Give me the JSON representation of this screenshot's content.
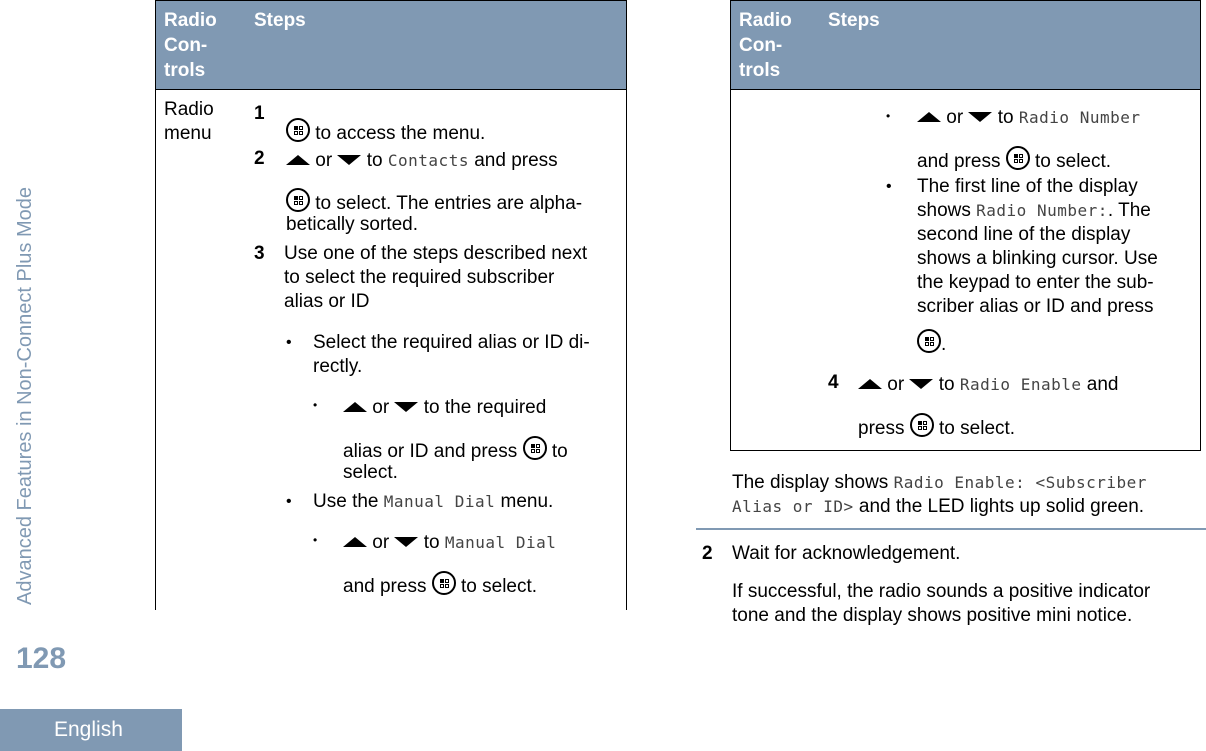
{
  "sidebar": {
    "section_title": "Advanced Features in Non-Connect Plus Mode",
    "page_number": "128",
    "language": "English"
  },
  "table_header": {
    "col1": [
      "Radio",
      "Con-",
      "trols"
    ],
    "col2": "Steps"
  },
  "left_table": {
    "row_label": [
      "Radio",
      "menu"
    ],
    "step1": {
      "num": "1",
      "text": "to access the menu."
    },
    "step2": {
      "num": "2",
      "or": "or",
      "to": "to",
      "target": "Contacts",
      "and_press": "and press",
      "line2": "to select. The entries are alpha-",
      "line3": "betically sorted."
    },
    "step3": {
      "num": "3",
      "lines": [
        "Use one of the steps described next",
        "to select the required subscriber",
        "alias or ID"
      ]
    },
    "bullet1": {
      "lines": [
        "Select the required alias or ID di-",
        "rectly."
      ]
    },
    "sub1": {
      "or": "or",
      "text": "to the required",
      "line2a": "alias or ID and press",
      "line2b": "to",
      "line3": "select."
    },
    "bullet2": {
      "pre": "Use the",
      "mono": "Manual Dial",
      "post": "menu."
    },
    "sub2": {
      "or": "or",
      "to": "to",
      "mono": "Manual Dial",
      "line2a": "and press",
      "line2b": "to select."
    }
  },
  "right_table": {
    "sub1": {
      "or": "or",
      "to": "to",
      "mono": "Radio Number",
      "line2a": "and press",
      "line2b": "to select."
    },
    "bullet2": {
      "line1": "The first line of the display",
      "pre": "shows",
      "mono": "Radio Number:",
      "post": ". The",
      "lines": [
        "second line of the display",
        "shows a blinking cursor. Use",
        "the keypad to enter the sub-",
        "scriber alias or ID and press"
      ],
      "end": "."
    },
    "step4": {
      "num": "4",
      "or": "or",
      "to": "to",
      "mono": "Radio Enable",
      "post": "and",
      "line2a": "press",
      "line2b": "to select."
    }
  },
  "after_table": {
    "pre": "The display shows",
    "mono1": "Radio Enable: <Subscriber",
    "mono2": "Alias or ID>",
    "post": "and the LED lights up solid green."
  },
  "step2": {
    "num": "2",
    "text": "Wait for acknowledgement.",
    "lines": [
      "If successful, the radio sounds a positive indicator",
      "tone and the display shows positive mini notice."
    ]
  }
}
